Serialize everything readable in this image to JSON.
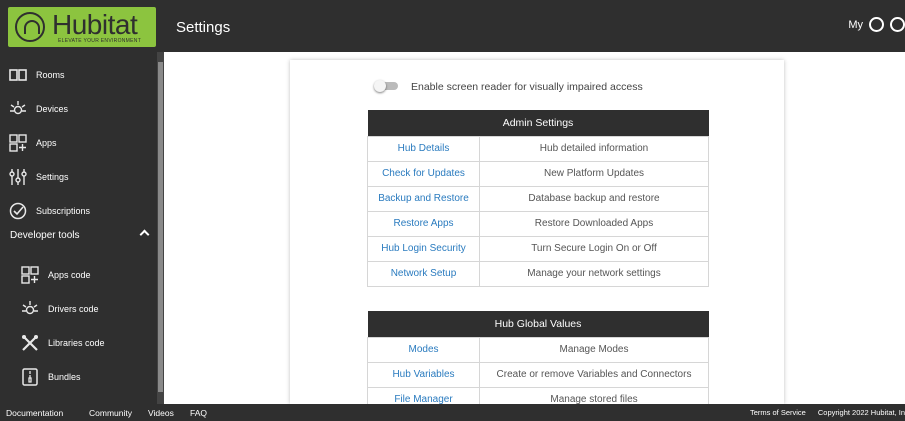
{
  "header": {
    "brand": "Hubitat",
    "tagline": "ELEVATE YOUR ENVIRONMENT",
    "title": "Settings",
    "right_label": "My"
  },
  "sidebar": {
    "items": [
      {
        "label": "Rooms",
        "icon": "rooms-icon"
      },
      {
        "label": "Devices",
        "icon": "devices-icon"
      },
      {
        "label": "Apps",
        "icon": "apps-icon"
      },
      {
        "label": "Settings",
        "icon": "settings-icon"
      },
      {
        "label": "Subscriptions",
        "icon": "subscriptions-icon"
      }
    ],
    "dev_section": "Developer tools",
    "dev_items": [
      {
        "label": "Apps code",
        "icon": "apps-code-icon"
      },
      {
        "label": "Drivers code",
        "icon": "drivers-code-icon"
      },
      {
        "label": "Libraries code",
        "icon": "libraries-code-icon"
      },
      {
        "label": "Bundles",
        "icon": "bundles-icon"
      }
    ]
  },
  "screen_reader_label": "Enable screen reader for visually impaired access",
  "admin": {
    "title": "Admin Settings",
    "rows": [
      {
        "link": "Hub Details",
        "desc": "Hub detailed information"
      },
      {
        "link": "Check for Updates",
        "desc": "New Platform Updates"
      },
      {
        "link": "Backup and Restore",
        "desc": "Database backup and restore"
      },
      {
        "link": "Restore Apps",
        "desc": "Restore Downloaded Apps"
      },
      {
        "link": "Hub Login Security",
        "desc": "Turn Secure Login On or Off"
      },
      {
        "link": "Network Setup",
        "desc": "Manage your network settings"
      }
    ]
  },
  "globals": {
    "title": "Hub Global Values",
    "rows": [
      {
        "link": "Modes",
        "desc": "Manage Modes"
      },
      {
        "link": "Hub Variables",
        "desc": "Create or remove Variables and Connectors"
      },
      {
        "link": "File Manager",
        "desc": "Manage stored files"
      }
    ]
  },
  "footer": {
    "links": [
      "Documentation",
      "Community",
      "Videos",
      "FAQ"
    ],
    "terms": "Terms of Service",
    "copyright": "Copyright 2022 Hubitat, In"
  },
  "colors": {
    "accent": "#8cc43f",
    "dark": "#2f2f2f",
    "link": "#2a7bbf"
  }
}
